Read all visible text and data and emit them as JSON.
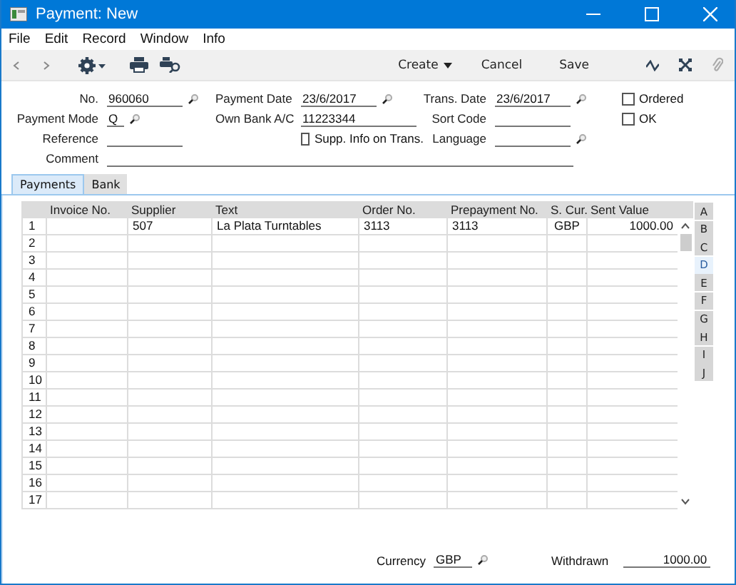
{
  "window": {
    "title": "Payment: New"
  },
  "menu": [
    "File",
    "Edit",
    "Record",
    "Window",
    "Info"
  ],
  "toolbar": {
    "buttons": [
      "Create",
      "Cancel",
      "Save"
    ]
  },
  "form": {
    "rows": [
      [
        {
          "label": "No.",
          "value": "960060",
          "lookup": true,
          "kind": "field"
        },
        {
          "label": "Payment Date",
          "value": "23/6/2017",
          "lookup": true,
          "kind": "field"
        },
        {
          "label": "Trans. Date",
          "value": "23/6/2017",
          "lookup": true,
          "kind": "field"
        },
        {
          "label": "Ordered",
          "checked": false,
          "kind": "check"
        }
      ],
      [
        {
          "label": "Payment Mode",
          "value": "Q",
          "lookup": true,
          "kind": "short"
        },
        {
          "label": "Own Bank A/C",
          "value": "11223344",
          "lookup": false,
          "kind": "field"
        },
        {
          "label": "Sort Code",
          "lookup": false,
          "kind": "field"
        },
        {
          "label": "OK",
          "checked": false,
          "kind": "check"
        }
      ],
      [
        {
          "label": "Reference",
          "lookup": false,
          "kind": "field"
        },
        {
          "label": "Supp. Info on Trans.",
          "checked": false,
          "kind": "check"
        },
        {
          "label": "Language",
          "lookup": true,
          "kind": "field"
        }
      ]
    ],
    "comment": {
      "label": "Comment"
    }
  },
  "tabs": [
    {
      "label": "Payments",
      "selected": true
    },
    {
      "label": "Bank",
      "selected": false
    }
  ],
  "table": {
    "columns": [
      "Invoice No.",
      "Supplier",
      "Text",
      "Order No.",
      "Prepayment No.",
      "S. Cur.",
      "Sent Value"
    ],
    "rows": [
      {
        "number": "1",
        "cells": [
          "",
          "507",
          "La Plata Turntables",
          "3113",
          "3113",
          "GBP",
          "1000.00"
        ]
      },
      {
        "number": "2",
        "cells": []
      },
      {
        "number": "3",
        "cells": []
      },
      {
        "number": "4",
        "cells": []
      },
      {
        "number": "5",
        "cells": []
      },
      {
        "number": "6",
        "cells": []
      },
      {
        "number": "7",
        "cells": []
      },
      {
        "number": "8",
        "cells": []
      },
      {
        "number": "9",
        "cells": []
      },
      {
        "number": "10",
        "cells": []
      },
      {
        "number": "11",
        "cells": []
      },
      {
        "number": "12",
        "cells": []
      },
      {
        "number": "13",
        "cells": []
      },
      {
        "number": "14",
        "cells": []
      },
      {
        "number": "15",
        "cells": []
      },
      {
        "number": "16",
        "cells": []
      },
      {
        "number": "17",
        "cells": []
      }
    ]
  },
  "letter_tabs": [
    {
      "label": "A",
      "selected": false
    },
    {
      "label": "B",
      "selected": false
    },
    {
      "label": "C",
      "selected": false
    },
    {
      "label": "D",
      "selected": true
    },
    {
      "label": "E",
      "selected": false
    },
    {
      "label": "F",
      "selected": false
    },
    {
      "label": "G",
      "selected": false
    },
    {
      "label": "H",
      "selected": false
    },
    {
      "label": "I",
      "selected": false
    },
    {
      "label": "J",
      "selected": false
    }
  ],
  "footer": {
    "currency": {
      "label": "Currency",
      "value": "GBP"
    },
    "withdrawn": {
      "label": "Withdrawn",
      "value": "1000.00"
    }
  }
}
